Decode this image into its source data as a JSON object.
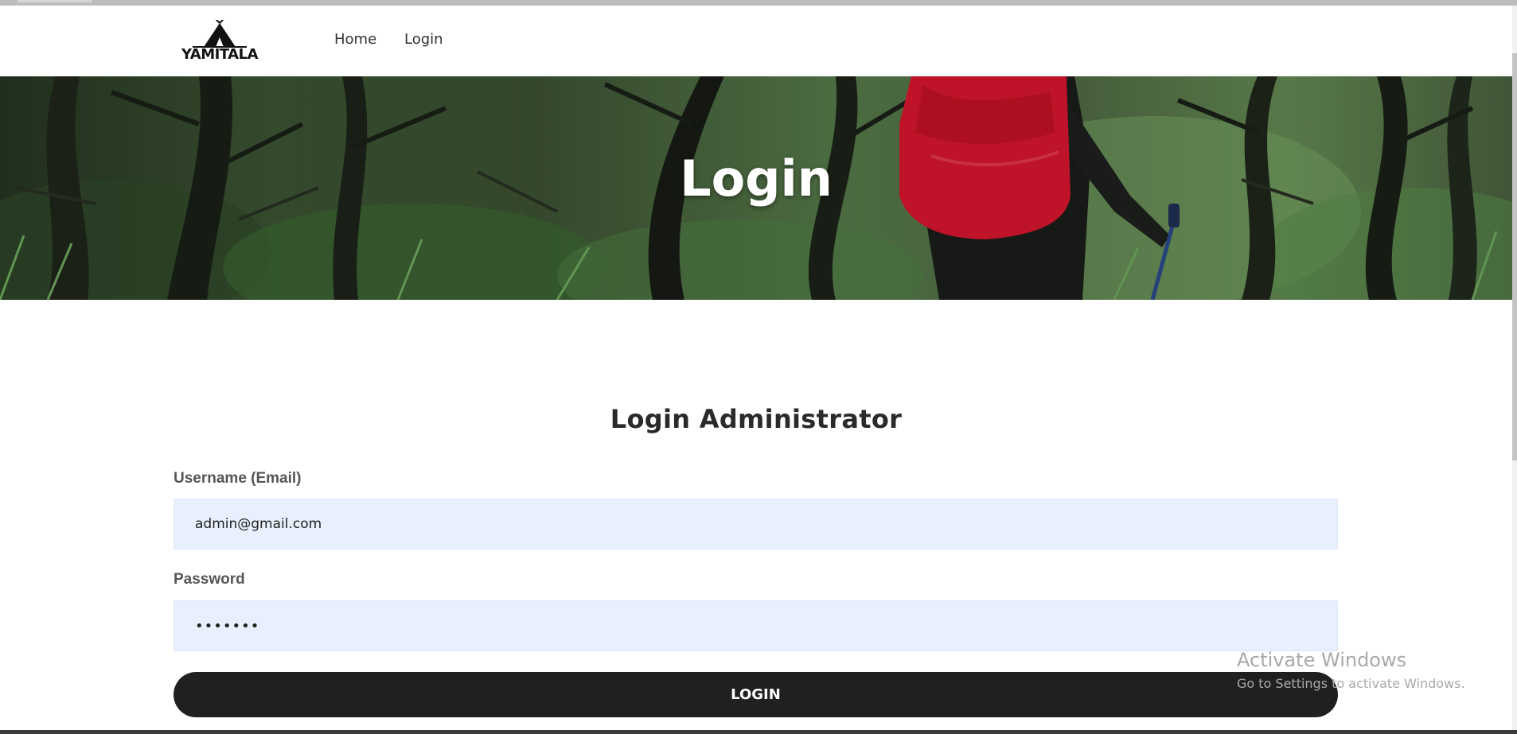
{
  "brand": {
    "name": "YAMITALA"
  },
  "nav": {
    "items": [
      {
        "label": "Home"
      },
      {
        "label": "Login"
      }
    ]
  },
  "hero": {
    "title": "Login"
  },
  "form": {
    "title": "Login Administrator",
    "username_label": "Username (Email)",
    "username_value": "admin@gmail.com",
    "password_label": "Password",
    "password_value": "•••••••",
    "submit_label": "LOGIN"
  },
  "watermark": {
    "title": "Activate Windows",
    "subtitle": "Go to Settings to activate Windows."
  },
  "colors": {
    "input_background": "#e8f0fe",
    "button_background": "#202020",
    "button_text": "#ffffff",
    "hero_title": "#ffffff",
    "backpack": "#d9162e"
  }
}
